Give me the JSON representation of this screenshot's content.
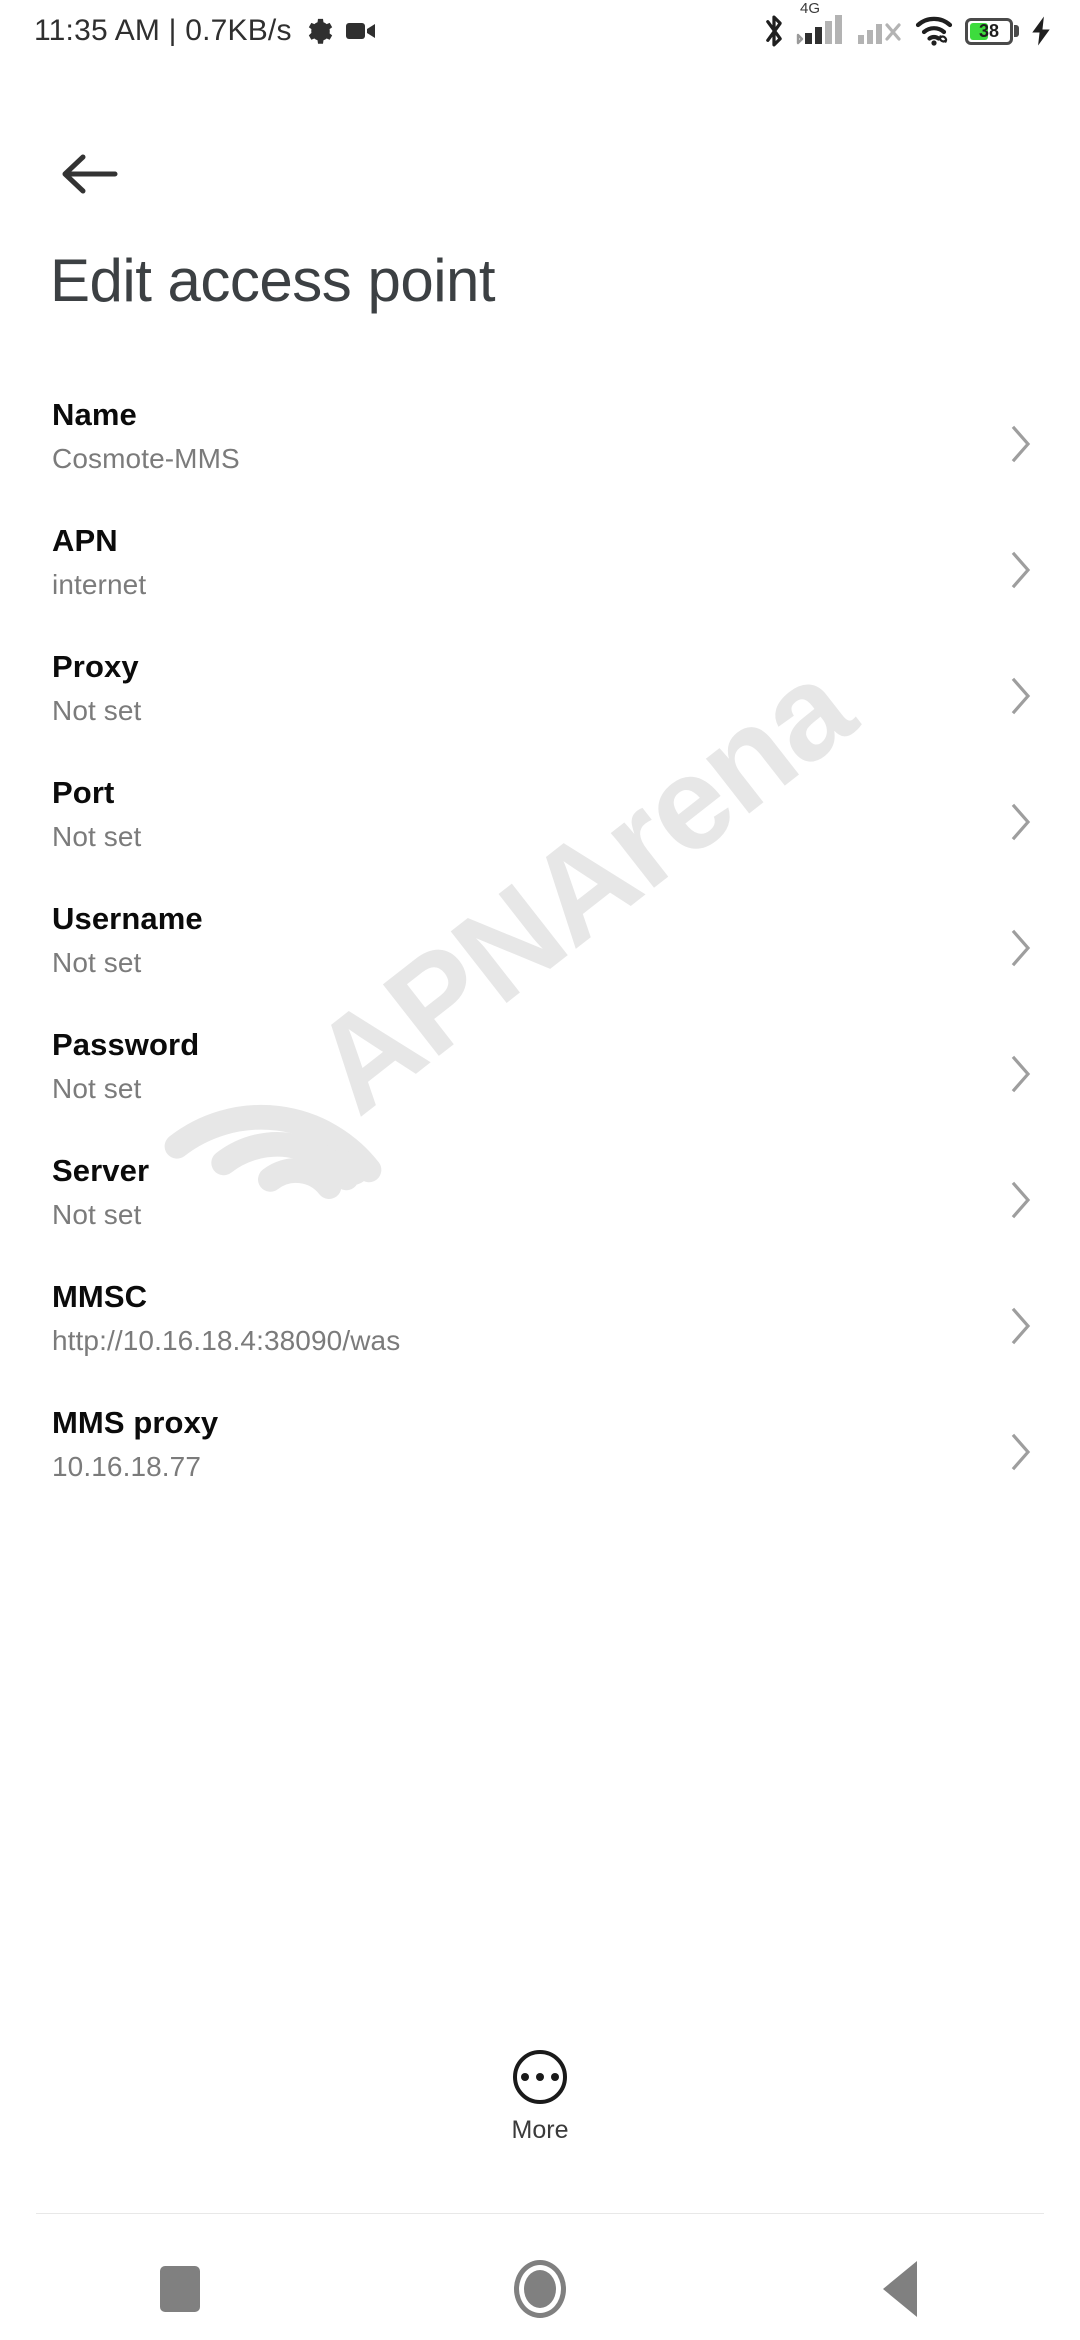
{
  "statusbar": {
    "time_and_speed": "11:35 AM | 0.7KB/s",
    "gear_icon": "gear-icon",
    "camera_icon": "video-camera-icon",
    "bluetooth_icon": "bluetooth-icon",
    "network_type": "4G",
    "sim1_icon": "signal-bars-sim1-icon",
    "sim2_icon": "signal-bars-sim2-no-service-icon",
    "wifi_icon": "wifi-with-link-icon",
    "battery_percent": "38",
    "charging_icon": "charging-bolt-icon"
  },
  "header": {
    "back_icon": "back-arrow-icon",
    "title": "Edit access point"
  },
  "watermark": {
    "text": "APNArena",
    "logo_icon": "wifi-arc-logo-icon",
    "color": "#e7e7e7"
  },
  "list": {
    "chevron_icon": "chevron-right-icon",
    "items": [
      {
        "label": "Name",
        "value": "Cosmote-MMS"
      },
      {
        "label": "APN",
        "value": "internet"
      },
      {
        "label": "Proxy",
        "value": "Not set"
      },
      {
        "label": "Port",
        "value": "Not set"
      },
      {
        "label": "Username",
        "value": "Not set"
      },
      {
        "label": "Password",
        "value": "Not set"
      },
      {
        "label": "Server",
        "value": "Not set"
      },
      {
        "label": "MMSC",
        "value": "http://10.16.18.4:38090/was"
      },
      {
        "label": "MMS proxy",
        "value": "10.16.18.77"
      }
    ]
  },
  "more": {
    "label": "More",
    "icon": "more-dots-circle-icon"
  },
  "navbar": {
    "recents_icon": "recents-square-icon",
    "home_icon": "home-circle-icon",
    "back_icon": "back-triangle-icon"
  },
  "colors": {
    "background": "#ffffff",
    "title": "#3c4043",
    "label": "#0b0b0b",
    "value": "#7b7b7b",
    "battery_fill": "#3ddc3d",
    "nav": "#808080"
  }
}
